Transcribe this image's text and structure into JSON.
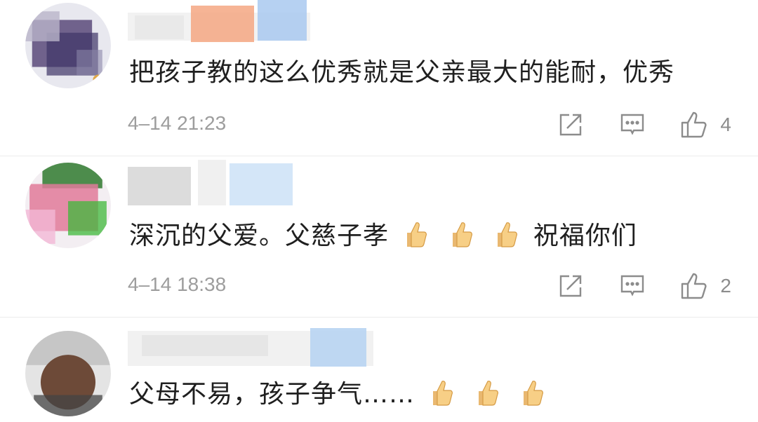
{
  "comments": [
    {
      "text": "把孩子教的这么优秀就是父亲最大的能耐，优秀",
      "time": "4–14 21:23",
      "likes": "4"
    },
    {
      "text": "深沉的父爱。父慈子孝",
      "text_after_emoji": "祝福你们",
      "time": "4–14 18:38",
      "likes": "2"
    },
    {
      "text": "父母不易，孩子争气……"
    }
  ],
  "icons": {
    "repost": "share-square-icon",
    "comment": "comment-bubble-icon",
    "like": "thumbs-up-outline-icon",
    "emoji": "thumbs-up-emoji"
  },
  "colors": {
    "text": "#1f1f1f",
    "meta": "#9d9d9d",
    "icon": "#8c8c8c",
    "divider": "#ececec"
  }
}
